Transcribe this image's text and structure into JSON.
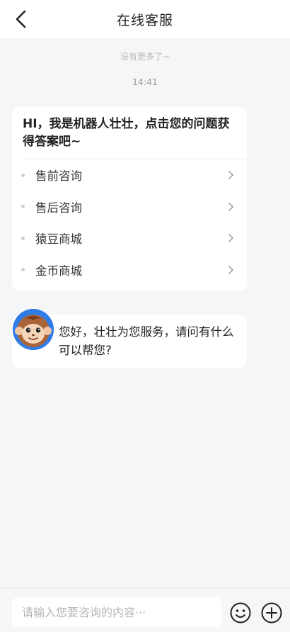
{
  "header": {
    "title": "在线客服",
    "back_icon": "chevron-left-icon"
  },
  "chat": {
    "more_note": "没有更多了~",
    "timestamp": "14:41",
    "bot_card": {
      "greeting": "HI，我是机器人壮壮，点击您的问题获得答案吧~",
      "questions": [
        {
          "label": "售前咨询"
        },
        {
          "label": "售后咨询"
        },
        {
          "label": "猿豆商城"
        },
        {
          "label": "金币商城"
        }
      ]
    },
    "bot_reply": "您好，壮壮为您服务，请问有什么可以帮您?"
  },
  "composer": {
    "placeholder": "请输入您要咨询的内容···",
    "emoji_icon": "smiley-icon",
    "plus_icon": "plus-circle-icon"
  },
  "colors": {
    "background": "#f5f6f7",
    "avatar_bg": "#2f7be8"
  }
}
